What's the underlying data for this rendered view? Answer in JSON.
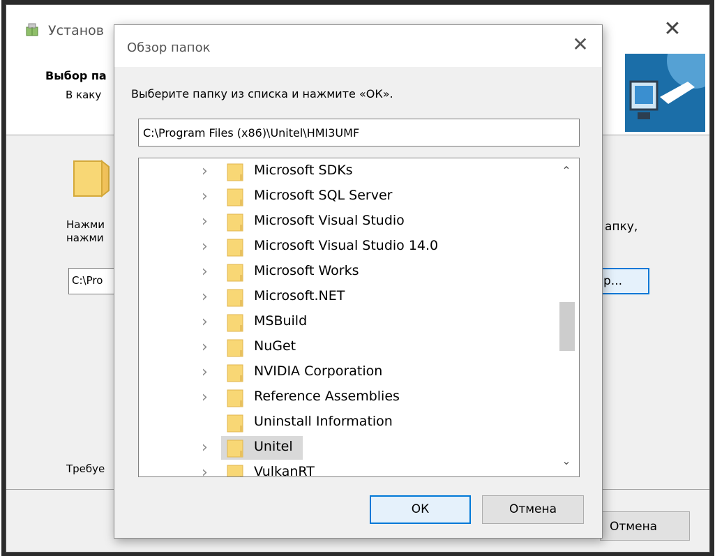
{
  "installer": {
    "title": "Установ",
    "close_glyph": "✕",
    "step_title": "Выбор па",
    "step_subtitle": "В каку",
    "instruction_left_line1": "Нажми",
    "instruction_left_line2": "нажми",
    "instruction_right": "апку,",
    "path_value": "C:\\Pro",
    "browse_label": "р...",
    "space_required": "Требуе",
    "cancel_label": "Отмена",
    "icons": [
      "installer-app-icon",
      "folder-icon",
      "banner-computer-icon"
    ]
  },
  "dialog": {
    "title": "Обзор папок",
    "close_glyph": "✕",
    "prompt": "Выберите папку из списка и нажмите «ОК».",
    "path": "C:\\Program Files (x86)\\Unitel\\HMI3UMF",
    "tree": {
      "items": [
        {
          "label": "Microsoft SDKs",
          "expandable": true,
          "selected": false
        },
        {
          "label": "Microsoft SQL Server",
          "expandable": true,
          "selected": false
        },
        {
          "label": "Microsoft Visual Studio",
          "expandable": true,
          "selected": false
        },
        {
          "label": "Microsoft Visual Studio 14.0",
          "expandable": true,
          "selected": false
        },
        {
          "label": "Microsoft Works",
          "expandable": true,
          "selected": false
        },
        {
          "label": "Microsoft.NET",
          "expandable": true,
          "selected": false
        },
        {
          "label": "MSBuild",
          "expandable": true,
          "selected": false
        },
        {
          "label": "NuGet",
          "expandable": true,
          "selected": false
        },
        {
          "label": "NVIDIA Corporation",
          "expandable": true,
          "selected": false
        },
        {
          "label": "Reference Assemblies",
          "expandable": true,
          "selected": false
        },
        {
          "label": "Uninstall Information",
          "expandable": false,
          "selected": false
        },
        {
          "label": "Unitel",
          "expandable": true,
          "selected": true
        },
        {
          "label": "VulkanRT",
          "expandable": true,
          "selected": false
        }
      ],
      "chevron_glyph": "›",
      "scroll_up_glyph": "⌃",
      "scroll_down_glyph": "⌄"
    },
    "ok_label": "ОК",
    "cancel_label": "Отмена"
  },
  "colors": {
    "accent": "#0078d7",
    "folder": "#f8d775",
    "selection": "#d9d9d9"
  }
}
